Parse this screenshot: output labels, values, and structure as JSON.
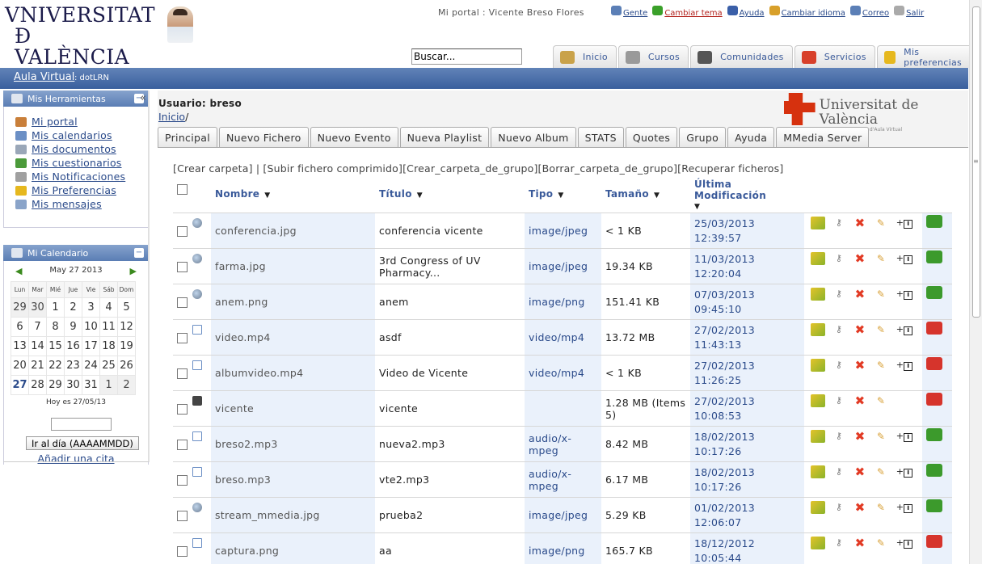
{
  "logo": {
    "line1": "VNIVERSITAT",
    "line2": "Ð VALÈNCIA"
  },
  "portal": "Mi portal : Vicente Breso Flores",
  "toplinks": [
    {
      "label": "Gente",
      "color": "#2a4a8a",
      "icon": "people-icon",
      "iconColor": "#5b7fb6"
    },
    {
      "label": "Cambiar tema",
      "color": "#b3221d",
      "icon": "theme-icon",
      "iconColor": "#3aa02a"
    },
    {
      "label": "Ayuda",
      "color": "#2a4a8a",
      "icon": "help-icon",
      "iconColor": "#3a5fa8"
    },
    {
      "label": "Cambiar idioma",
      "color": "#2a4a8a",
      "icon": "flag-icon",
      "iconColor": "#d8a02a"
    },
    {
      "label": "Correo",
      "color": "#2a4a8a",
      "icon": "mail-icon",
      "iconColor": "#5b7fb6"
    },
    {
      "label": "Salir",
      "color": "#2a4a8a",
      "icon": "exit-icon",
      "iconColor": "#aaaaaa"
    }
  ],
  "search": {
    "value": "Buscar..."
  },
  "navtabs": [
    {
      "label": "Inicio",
      "icon": "home-icon",
      "iconColor": "#c9a24a"
    },
    {
      "label": "Cursos",
      "icon": "courses-icon",
      "iconColor": "#9a9a9a"
    },
    {
      "label": "Comunidades",
      "icon": "communities-icon",
      "iconColor": "#555555"
    },
    {
      "label": "Servicios",
      "icon": "services-icon",
      "iconColor": "#d8402a"
    },
    {
      "label": "Mis preferencias",
      "icon": "star-icon",
      "iconColor": "#e6b81e"
    }
  ],
  "bluebar": {
    "link": "Aula Virtual",
    "suffix": ": dotLRN"
  },
  "sidebar": {
    "tools_title": "Mis Herramientas",
    "tools": [
      {
        "label": "Mi portal",
        "icon": "portal-icon",
        "iconColor": "#c97f3a"
      },
      {
        "label": "Mis calendarios",
        "icon": "calendar-icon",
        "iconColor": "#6b8fc5"
      },
      {
        "label": "Mis documentos",
        "icon": "documents-icon",
        "iconColor": "#9aa7b8"
      },
      {
        "label": "Mis cuestionarios",
        "icon": "quiz-icon",
        "iconColor": "#4b9a3a"
      },
      {
        "label": "Mis Notificaciones",
        "icon": "notification-icon",
        "iconColor": "#a0a0a0"
      },
      {
        "label": "Mis Preferencias",
        "icon": "star-icon",
        "iconColor": "#e6b81e"
      },
      {
        "label": "Mis mensajes",
        "icon": "message-icon",
        "iconColor": "#8aa4c9"
      }
    ],
    "calendar_title": "Mi Calendario",
    "month": "May 27 2013",
    "weekdays": [
      "Lun",
      "Mar",
      "Mié",
      "Jue",
      "Vie",
      "Sáb",
      "Dom"
    ],
    "weeks": [
      [
        {
          "d": "29",
          "o": true
        },
        {
          "d": "30",
          "o": true
        },
        {
          "d": "1"
        },
        {
          "d": "2"
        },
        {
          "d": "3"
        },
        {
          "d": "4"
        },
        {
          "d": "5"
        }
      ],
      [
        {
          "d": "6"
        },
        {
          "d": "7"
        },
        {
          "d": "8"
        },
        {
          "d": "9"
        },
        {
          "d": "10"
        },
        {
          "d": "11"
        },
        {
          "d": "12"
        }
      ],
      [
        {
          "d": "13"
        },
        {
          "d": "14"
        },
        {
          "d": "15"
        },
        {
          "d": "16"
        },
        {
          "d": "17"
        },
        {
          "d": "18"
        },
        {
          "d": "19"
        }
      ],
      [
        {
          "d": "20"
        },
        {
          "d": "21"
        },
        {
          "d": "22"
        },
        {
          "d": "23"
        },
        {
          "d": "24"
        },
        {
          "d": "25"
        },
        {
          "d": "26"
        }
      ],
      [
        {
          "d": "27",
          "t": true
        },
        {
          "d": "28"
        },
        {
          "d": "29"
        },
        {
          "d": "30"
        },
        {
          "d": "31"
        },
        {
          "d": "1",
          "o": true
        },
        {
          "d": "2",
          "o": true
        }
      ]
    ],
    "today": "Hoy es 27/05/13",
    "goto_button": "Ir al día (AAAAMMDD)",
    "add_link": "Añadir una cita"
  },
  "main": {
    "user": "Usuario: breso",
    "crumb": "Inicio",
    "crumb_sep": "/",
    "uv_name": "Universitat de València",
    "uv_sub": "Servidor Multimèdia d'Aula Virtual",
    "tabs": [
      "Principal",
      "Nuevo Fichero",
      "Nuevo Evento",
      "Nueva Playlist",
      "Nuevo Album",
      "STATS",
      "Quotes",
      "Grupo",
      "Ayuda",
      "MMedia Server"
    ],
    "actions": "[Crear carpeta] | [Subir fichero comprimido][Crear_carpeta_de_grupo][Borrar_carpeta_de_grupo][Recuperar ficheros]",
    "columns": {
      "name": "Nombre",
      "title": "Título",
      "type": "Tipo",
      "size": "Tamaño",
      "modified": "Última Modificación"
    },
    "files": [
      {
        "icon": "globe",
        "name": "conferencia.jpg",
        "title": "conferencia vicente",
        "type": "image/jpeg",
        "size": "< 1 KB",
        "date": "25/03/2013",
        "time": "12:39:57",
        "info": true,
        "lock": "green"
      },
      {
        "icon": "globe",
        "name": "farma.jpg",
        "title": "3rd Congress of UV Pharmacy...",
        "type": "image/jpeg",
        "size": "19.34 KB",
        "date": "11/03/2013",
        "time": "12:20:04",
        "info": true,
        "lock": "green"
      },
      {
        "icon": "globe",
        "name": "anem.png",
        "title": "anem",
        "type": "image/png",
        "size": "151.41 KB",
        "date": "07/03/2013",
        "time": "09:45:10",
        "info": true,
        "lock": "green"
      },
      {
        "icon": "doc",
        "name": "video.mp4",
        "title": "asdf",
        "type": "video/mp4",
        "size": "13.72 MB",
        "date": "27/02/2013",
        "time": "11:43:13",
        "info": true,
        "lock": "red"
      },
      {
        "icon": "doc",
        "name": "albumvideo.mp4",
        "title": "Video de Vicente",
        "type": "video/mp4",
        "size": "< 1 KB",
        "date": "27/02/2013",
        "time": "11:26:25",
        "info": true,
        "lock": "red"
      },
      {
        "icon": "cam",
        "name": "vicente",
        "title": "vicente",
        "type": "",
        "size": "1.28 MB (Items 5)",
        "date": "27/02/2013",
        "time": "10:08:53",
        "info": false,
        "lock": "red"
      },
      {
        "icon": "doc",
        "name": "breso2.mp3",
        "title": "nueva2.mp3",
        "type": "audio/x-mpeg",
        "size": "8.42 MB",
        "date": "18/02/2013",
        "time": "10:17:26",
        "info": true,
        "lock": "share"
      },
      {
        "icon": "doc",
        "name": "breso.mp3",
        "title": "vte2.mp3",
        "type": "audio/x-mpeg",
        "size": "6.17 MB",
        "date": "18/02/2013",
        "time": "10:17:26",
        "info": true,
        "lock": "share"
      },
      {
        "icon": "globe",
        "name": "stream_mmedia.jpg",
        "title": "prueba2",
        "type": "image/jpeg",
        "size": "5.29 KB",
        "date": "01/02/2013",
        "time": "12:06:07",
        "info": true,
        "lock": "green"
      },
      {
        "icon": "doc",
        "name": "captura.png",
        "title": "aa",
        "type": "image/png",
        "size": "165.7 KB",
        "date": "18/12/2012",
        "time": "10:05:44",
        "info": true,
        "lock": "red"
      }
    ]
  }
}
